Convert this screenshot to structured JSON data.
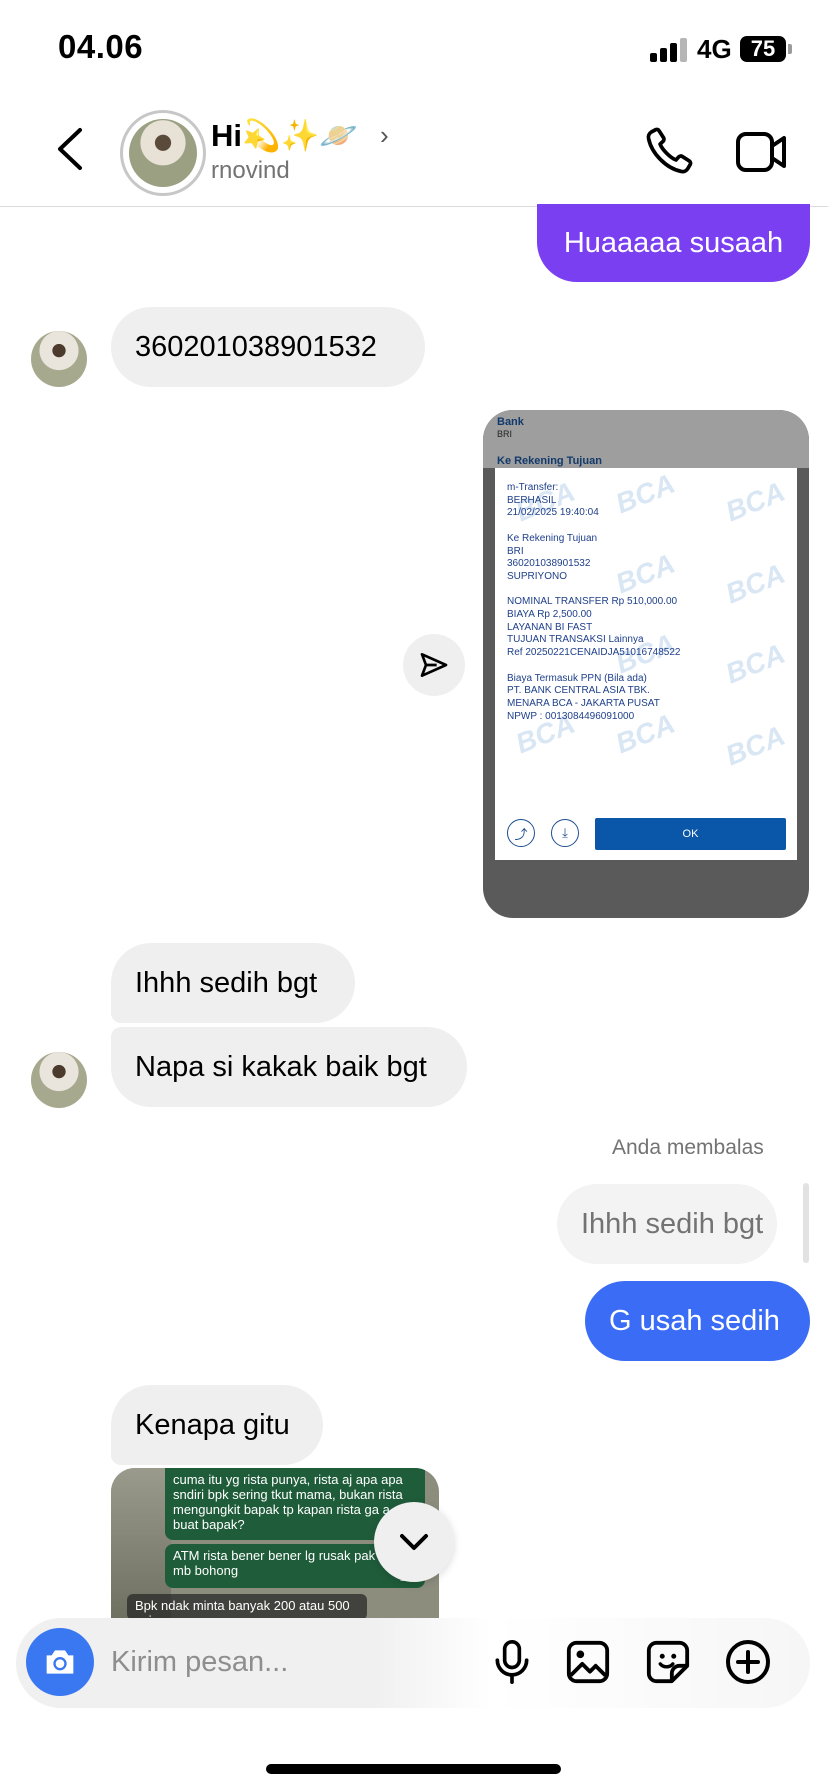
{
  "status_bar": {
    "time": "04.06",
    "network": "4G",
    "battery": "75"
  },
  "header": {
    "title": "Hi💫✨🪐",
    "username": "rnovind"
  },
  "messages": {
    "m1": "Huaaaaa susaah",
    "m2": "360201038901532",
    "m3": "Ihhh sedih bgt",
    "m4": "Napa si kakak baik bgt",
    "reply_label": "Anda membalas",
    "reply_quote": "Ihhh sedih bgt",
    "m5": "G usah sedih",
    "m6": "Kenapa gitu"
  },
  "receipt": {
    "bank_label": "Bank",
    "bank_value": "BRI",
    "ke_rekening": "Ke Rekening Tujuan",
    "lines": "m-Transfer:\nBERHASIL\n21/02/2025 19:40:04\n\nKe Rekening Tujuan\nBRI\n360201038901532\nSUPRIYONO\n\nNOMINAL TRANSFER Rp 510,000.00\nBIAYA Rp 2,500.00\nLAYANAN BI FAST\nTUJUAN TRANSAKSI Lainnya\nRef 20250221CENAIDJA51016748522\n\nBiaya Termasuk PPN (Bila ada)\nPT. BANK CENTRAL ASIA TBK.\nMENARA BCA - JAKARTA PUSAT\nNPWP : 0013084496091000",
    "watermark": "BCA",
    "ok": "OK"
  },
  "chat_image": {
    "bubble1": "cuma itu yg rista punya, rista aj apa apa sndiri bpk sering tkut mama, bukan rista mengungkit bapak tp kapan rista ga a buat bapak?",
    "bubble2": "ATM rista bener bener lg rusak pak apa mb bohong",
    "bubble2_time": "19.3",
    "bubble3": "Bpk ndak minta banyak 200 atau 500 saja"
  },
  "composer": {
    "placeholder": "Kirim pesan..."
  }
}
